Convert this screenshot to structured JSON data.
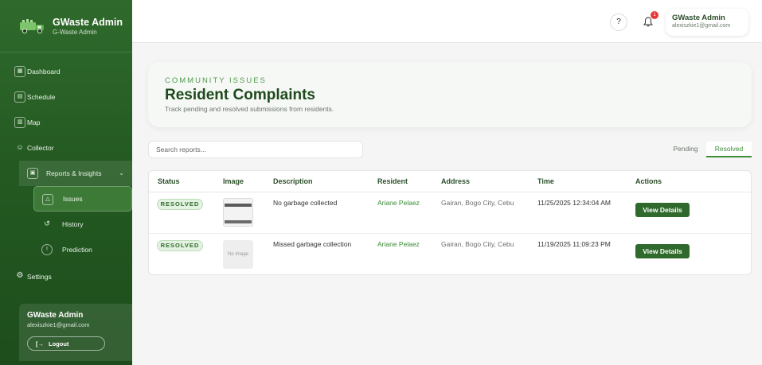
{
  "app": {
    "name": "GWaste Admin",
    "subtitle": "G-Waste Admin"
  },
  "sidebar": {
    "items": [
      {
        "label": "Dashboard",
        "icon": "grid-icon"
      },
      {
        "label": "Schedule",
        "icon": "calendar-icon"
      },
      {
        "label": "Map",
        "icon": "map-icon"
      },
      {
        "label": "Collector",
        "icon": "user-icon"
      },
      {
        "label": "Reports & Insights",
        "icon": "report-icon"
      }
    ],
    "subitems": [
      {
        "label": "Issues",
        "icon": "warning-icon",
        "active": true
      },
      {
        "label": "History",
        "icon": "history-icon"
      },
      {
        "label": "Prediction",
        "icon": "prediction-icon"
      }
    ],
    "settings": {
      "label": "Settings",
      "icon": "settings-icon"
    },
    "user": {
      "name": "GWaste Admin",
      "email": "alexiszkie1@gmail.com",
      "logout_label": "Logout"
    }
  },
  "topbar": {
    "notification_count": "1",
    "profile_name": "GWaste Admin",
    "profile_email": "alexiszkie1@gmail.com"
  },
  "hero": {
    "kicker": "COMMUNITY ISSUES",
    "title": "Resident Complaints",
    "subtitle": "Track pending and resolved submissions from residents."
  },
  "search": {
    "placeholder": "Search reports..."
  },
  "tabs": [
    {
      "label": "Pending",
      "active": false
    },
    {
      "label": "Resolved",
      "active": true
    }
  ],
  "table": {
    "headers": [
      "Status",
      "Image",
      "Description",
      "Resident",
      "Address",
      "Time",
      "Actions"
    ],
    "rows": [
      {
        "status": "RESOLVED",
        "image": "photo",
        "image_text": "",
        "description": "No garbage collected",
        "resident": "Ariane Pelaez",
        "address": "Gairan, Bogo City, Cebu",
        "time": "11/25/2025 12:34:04 AM",
        "action": "View Details"
      },
      {
        "status": "RESOLVED",
        "image": "none",
        "image_text": "No Image",
        "description": "Missed garbage collection",
        "resident": "Ariane Pelaez",
        "address": "Gairan, Bogo City, Cebu",
        "time": "11/19/2025 11:09:23 PM",
        "action": "View Details"
      }
    ]
  },
  "colors": {
    "sidebar": "#2f6a2c",
    "accent": "#3f8f3a",
    "title": "#1e4a1c",
    "badge_bg": "#e3f2e1",
    "alert": "#e53935"
  }
}
